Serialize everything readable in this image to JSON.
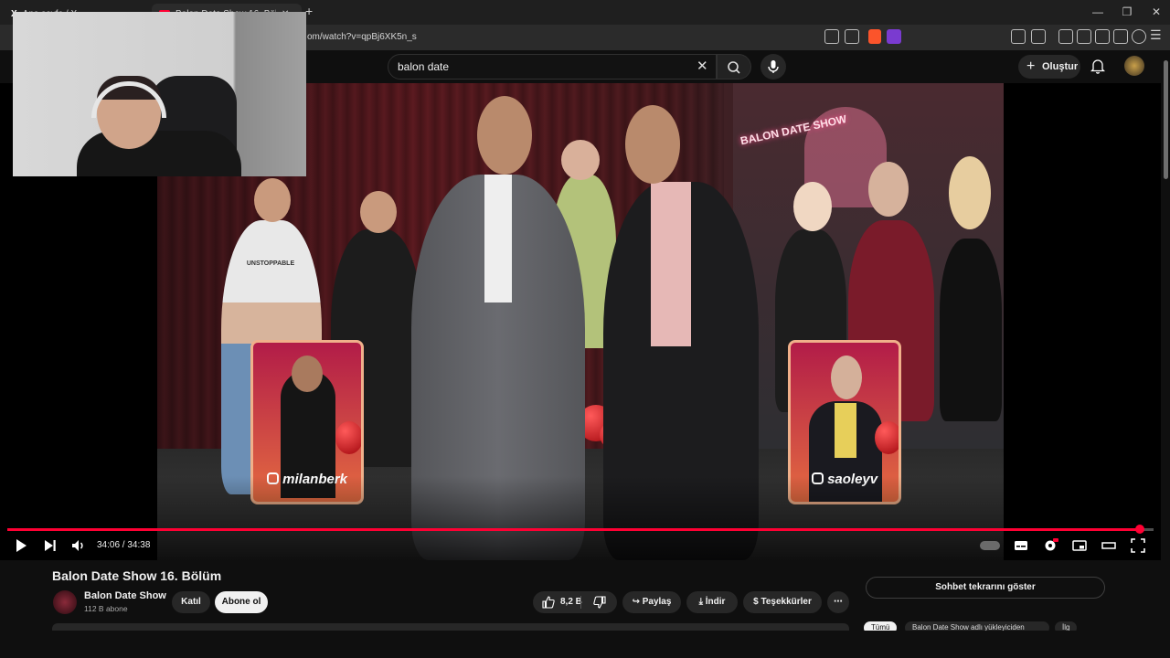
{
  "browser": {
    "tabs": [
      {
        "label": "Ana sayfa / X",
        "active": false
      },
      {
        "label": "Balon Date Show 16. Bölüm - YouTube",
        "active": true
      }
    ],
    "new_tab": "+",
    "url": "om/watch?v=qpBj6XK5n_s",
    "window_controls": {
      "minimize": "—",
      "maximize": "❐",
      "close": "✕"
    }
  },
  "header": {
    "search_value": "balon date",
    "create_label": "Oluştur"
  },
  "video": {
    "sign_text": "BALON DATE SHOW",
    "card_left_name": "milanberk",
    "card_right_name": "saoleyv",
    "tshirt_text": "UNSTOPPABLE",
    "progress": 0.988,
    "time": "34:06 / 34:38"
  },
  "meta": {
    "title": "Balon Date Show 16. Bölüm",
    "channel": "Balon Date Show",
    "subs": "112 B abone",
    "join_label": "Katıl",
    "subscribe_label": "Abone ol",
    "likes": "8,2 B",
    "share_label": "Paylaş",
    "download_label": "İndir",
    "thanks_label": "Teşekkürler",
    "chat_replay_label": "Sohbet tekrarını göster",
    "chips": [
      "Tümü",
      "Balon Date Show adlı yükleyiciden",
      "İlg"
    ]
  },
  "colors": {
    "accent": "#ff0033",
    "background": "#0f0f0f",
    "surface": "#272727"
  }
}
